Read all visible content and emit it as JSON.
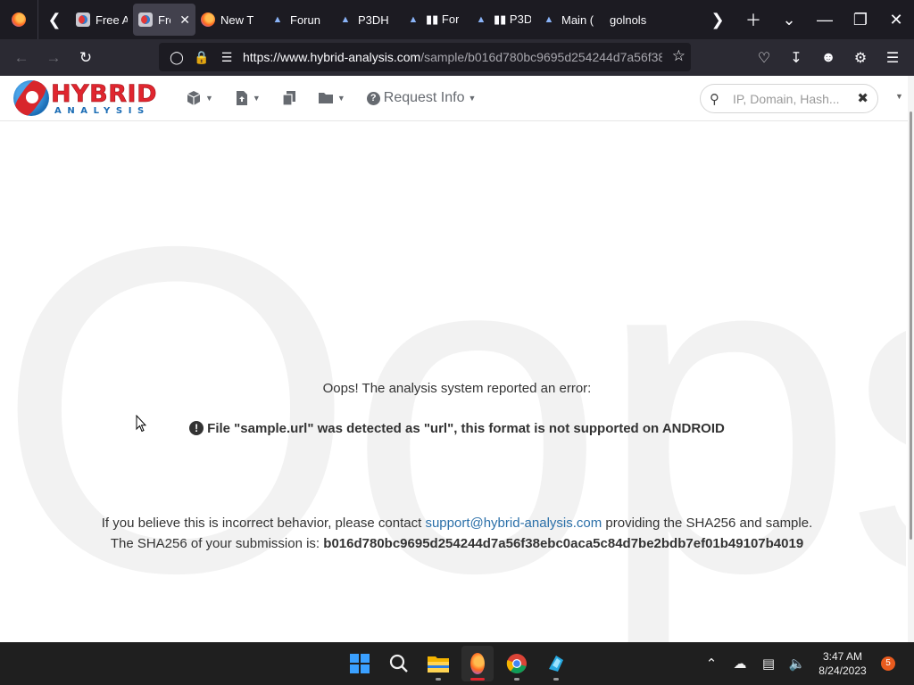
{
  "browser": {
    "tabs": [
      {
        "label": "Free A",
        "icon": "hybrid-analysis-favicon",
        "active": false
      },
      {
        "label": "Fre",
        "icon": "hybrid-analysis-favicon",
        "active": true
      },
      {
        "label": "New T",
        "icon": "firefox-favicon",
        "active": false
      },
      {
        "label": "Forun",
        "icon": "p3d-favicon",
        "active": false
      },
      {
        "label": "P3DH",
        "icon": "p3d-favicon",
        "active": false
      },
      {
        "label": "▮▮ For",
        "icon": "p3d-favicon",
        "active": false
      },
      {
        "label": "▮▮ P3D",
        "icon": "p3d-favicon",
        "active": false
      },
      {
        "label": "Main (",
        "icon": "p3d-favicon",
        "active": false
      },
      {
        "label": "golnols",
        "icon": "",
        "active": false
      }
    ],
    "url_host": "https://www.hybrid-analysis.com",
    "url_path": "/sample/b016d780bc9695d254244d7a56f38"
  },
  "site": {
    "logo_word1": "HYBRID",
    "logo_word2": "ANALYSIS",
    "nav": {
      "request_info": "Request Info"
    },
    "search_placeholder": "IP, Domain, Hash..."
  },
  "page": {
    "watermark": "Oops!",
    "error_heading": "Oops! The analysis system reported an error:",
    "error_detail": "File \"sample.url\" was detected as \"url\", this format is not supported on ANDROID",
    "contact_prefix": "If you believe this is incorrect behavior, please contact ",
    "contact_email": "support@hybrid-analysis.com",
    "contact_suffix": " providing the SHA256 and sample.",
    "sha_prefix": "The SHA256 of your submission is: ",
    "sha_value": "b016d780bc9695d254244d7a56f38ebc0aca5c84d7be2bdb7ef01b49107b4019"
  },
  "taskbar": {
    "time": "3:47 AM",
    "date": "8/24/2023",
    "notification_count": "5"
  },
  "colors": {
    "accent_red": "#e0262f",
    "accent_blue": "#1b6db5",
    "link": "#2a6fa8"
  }
}
